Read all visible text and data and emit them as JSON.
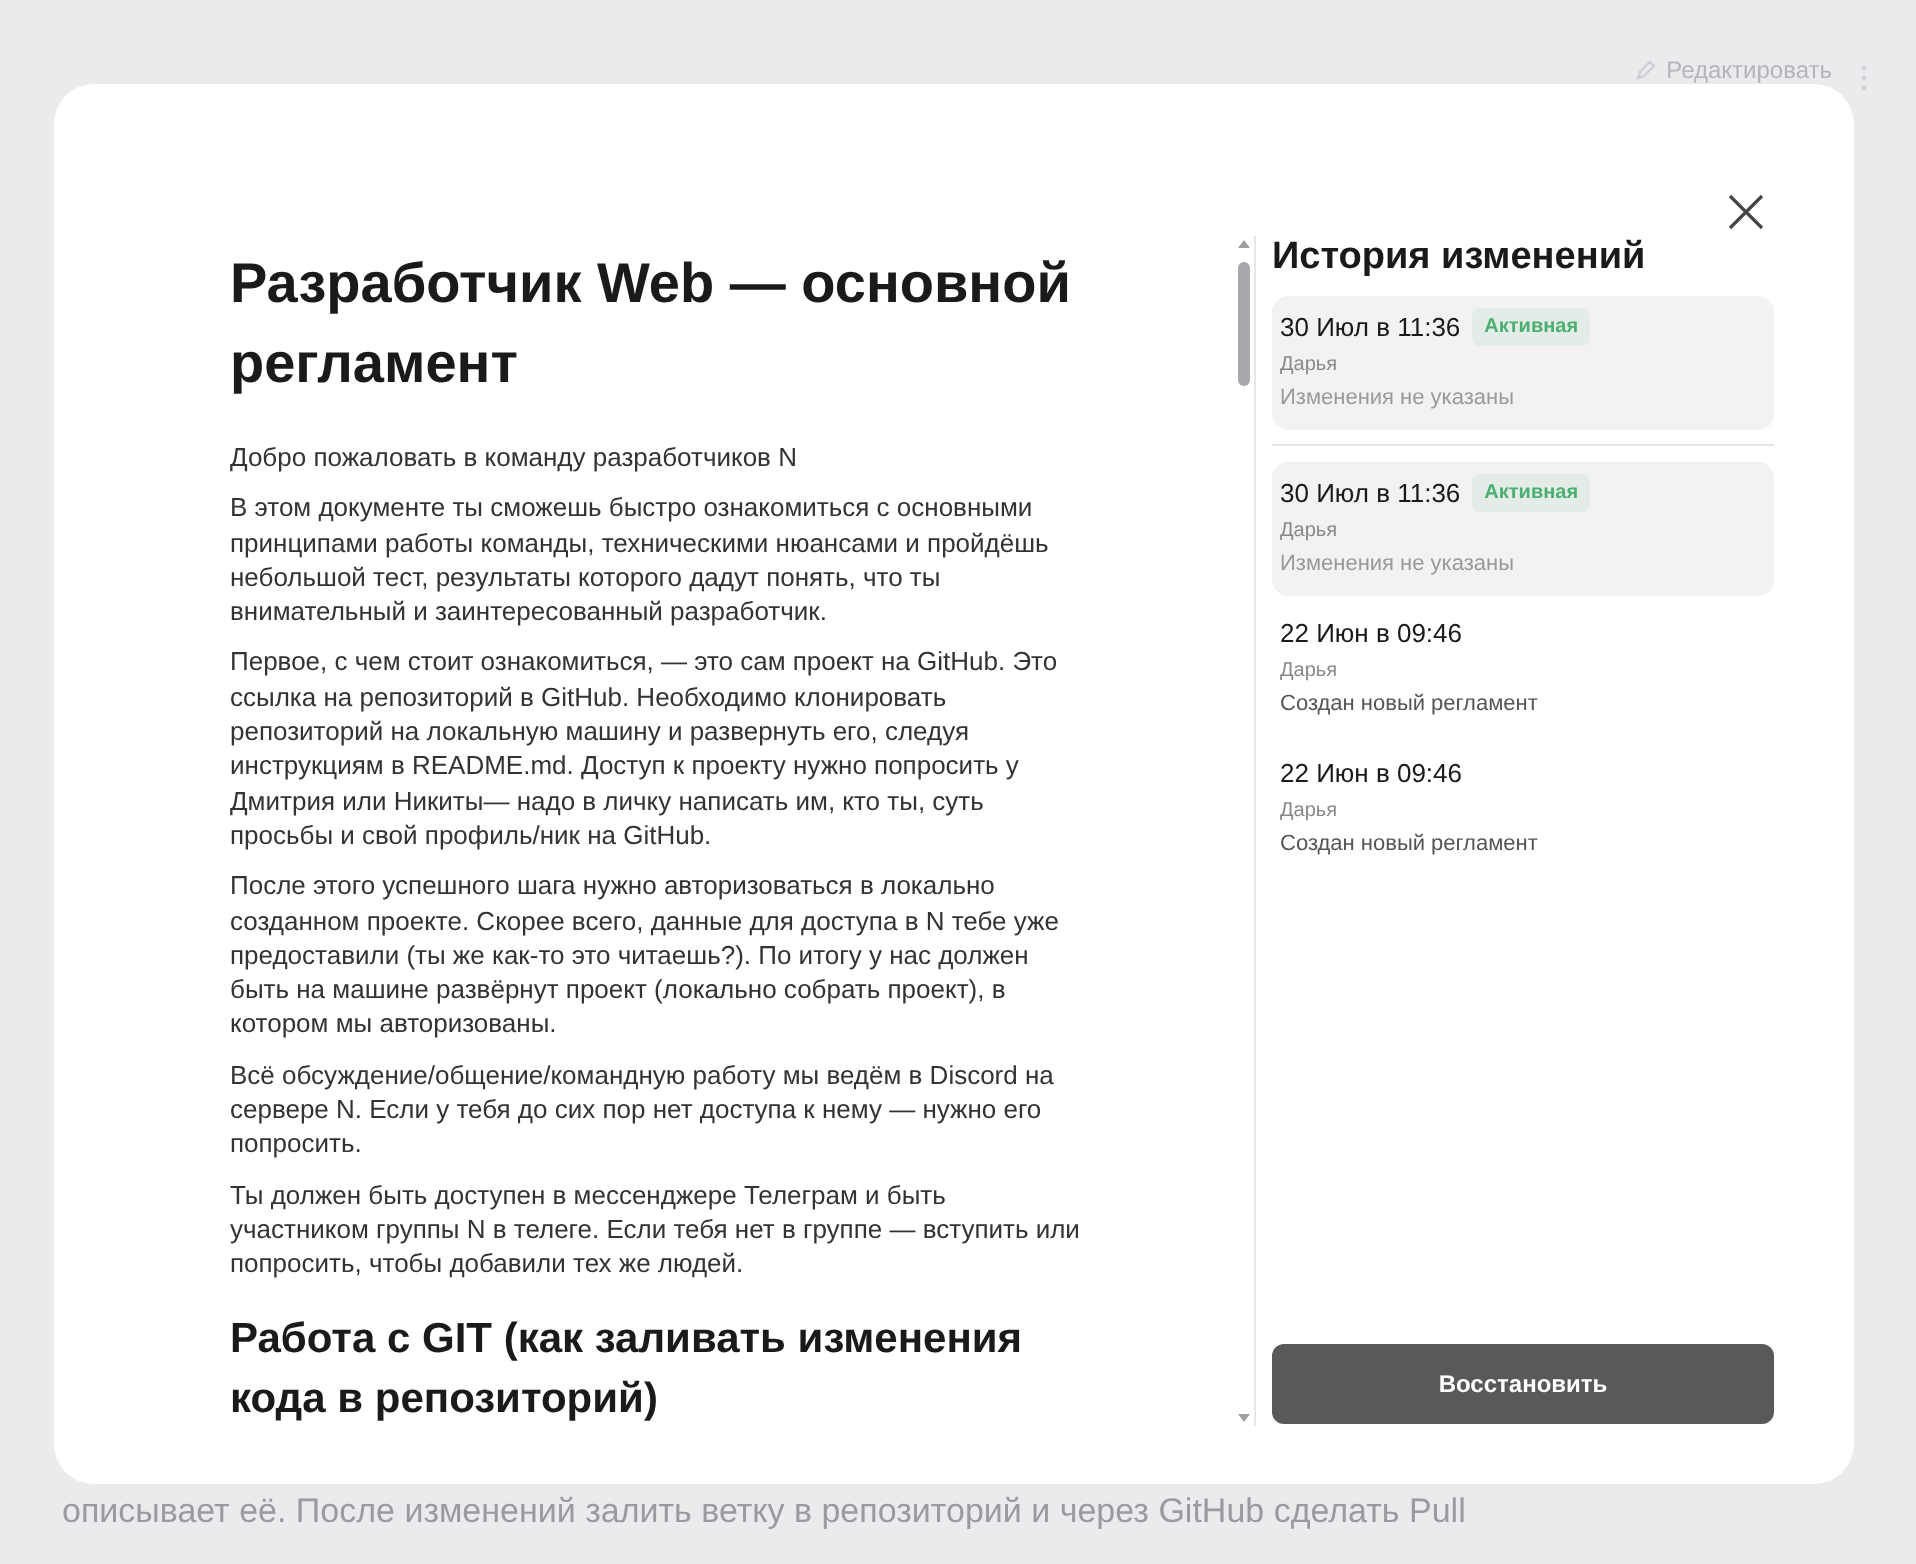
{
  "background": {
    "edit_button": "Редактировать",
    "text": "описывает её. После изменений залить ветку в репозиторий и через GitHub сделать Pull"
  },
  "document": {
    "blocks": [
      {
        "kind": "h1",
        "text": "Разработчик Web — основной регламент"
      },
      {
        "kind": "p",
        "text": "Добро пожаловать в команду разработчиков N"
      },
      {
        "kind": "p",
        "text": "В этом документе ты сможешь быстро ознакомиться с основными принципами работы команды, техническими нюансами и пройдёшь небольшой тест, результаты которого дадут понять, что ты внимательный и заинтересованный разработчик."
      },
      {
        "kind": "p",
        "text": "Первое, с чем стоит ознакомиться, — это сам проект на GitHub. Это ссылка на репозиторий в GitHub. Необходимо клонировать репозиторий на локальную машину и развернуть его, следуя инструкциям в README.md. Доступ к проекту нужно попросить у Дмитрия или Никиты— надо в личку написать им, кто ты, суть просьбы и свой профиль/ник на GitHub."
      },
      {
        "kind": "p",
        "text": "После этого успешного шага нужно авторизоваться в локально созданном проекте. Скорее всего, данные для доступа в N тебе уже предоставили (ты же как-то это читаешь?). По итогу у нас должен быть на машине развёрнут проект (локально собрать проект), в котором мы авторизованы."
      },
      {
        "kind": "p",
        "text": "Всё обсуждение/общение/командную работу мы ведём в Discord на сервере N. Если у тебя до сих пор нет доступа к нему — нужно его попросить."
      },
      {
        "kind": "p",
        "text": "Ты должен быть доступен в мессенджере Телеграм и быть участником группы N в телеге. Если тебя нет в группе — вступить или попросить, чтобы добавили тех же людей."
      },
      {
        "kind": "h2",
        "text": "Работа с GIT (как заливать изменения кода в репозиторий)"
      }
    ]
  },
  "history": {
    "title": "История изменений",
    "items": [
      {
        "date": "30 Июл в 11:36",
        "badge": "Активная",
        "author": "Дарья",
        "note": "Изменения не указаны",
        "note_muted": true,
        "selected": true,
        "divider_after": true
      },
      {
        "date": "30 Июл в 11:36",
        "badge": "Активная",
        "author": "Дарья",
        "note": "Изменения не указаны",
        "note_muted": true,
        "selected": true,
        "divider_after": false
      },
      {
        "date": "22 Июн в 09:46",
        "author": "Дарья",
        "note": "Создан новый регламент",
        "note_muted": false,
        "selected": false,
        "divider_after": false
      },
      {
        "date": "22 Июн в 09:46",
        "author": "Дарья",
        "note": "Создан новый регламент",
        "note_muted": false,
        "selected": false,
        "divider_after": false
      }
    ],
    "restore_button": "Восстановить"
  }
}
